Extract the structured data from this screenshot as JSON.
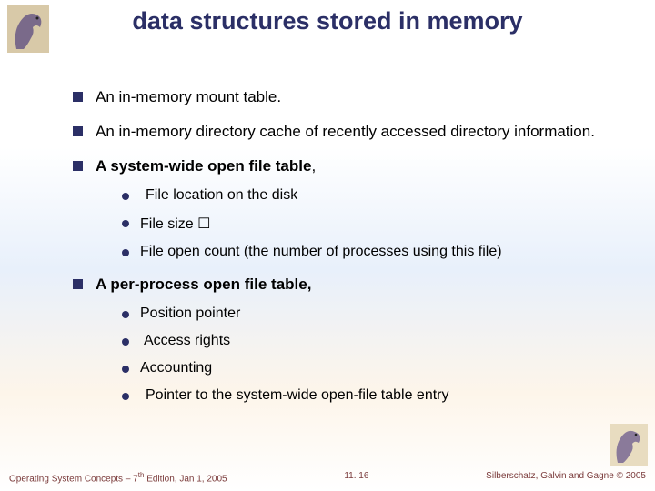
{
  "title": "data structures stored in memory",
  "bullets": {
    "b1": "An in-memory mount table.",
    "b2": "An in-memory directory cache of recently accessed directory information.",
    "b3_prefix": "A system-wide open file table",
    "b3_suffix": ",",
    "b3_sub1": "File location on the disk",
    "b3_sub2": "File size ☐",
    "b3_sub3": "File open count (the number of processes using this file)",
    "b4_prefix": "A per-process open file table,",
    "b4_sub1": "Position pointer",
    "b4_sub2": "Access rights",
    "b4_sub3": "Accounting",
    "b4_sub4": "Pointer to the system-wide open-file table entry"
  },
  "footer": {
    "left_a": "Operating System Concepts – 7",
    "left_sup": "th",
    "left_b": " Edition, Jan 1, 2005",
    "center": "11. 16",
    "right": "Silberschatz, Galvin and Gagne © 2005"
  }
}
